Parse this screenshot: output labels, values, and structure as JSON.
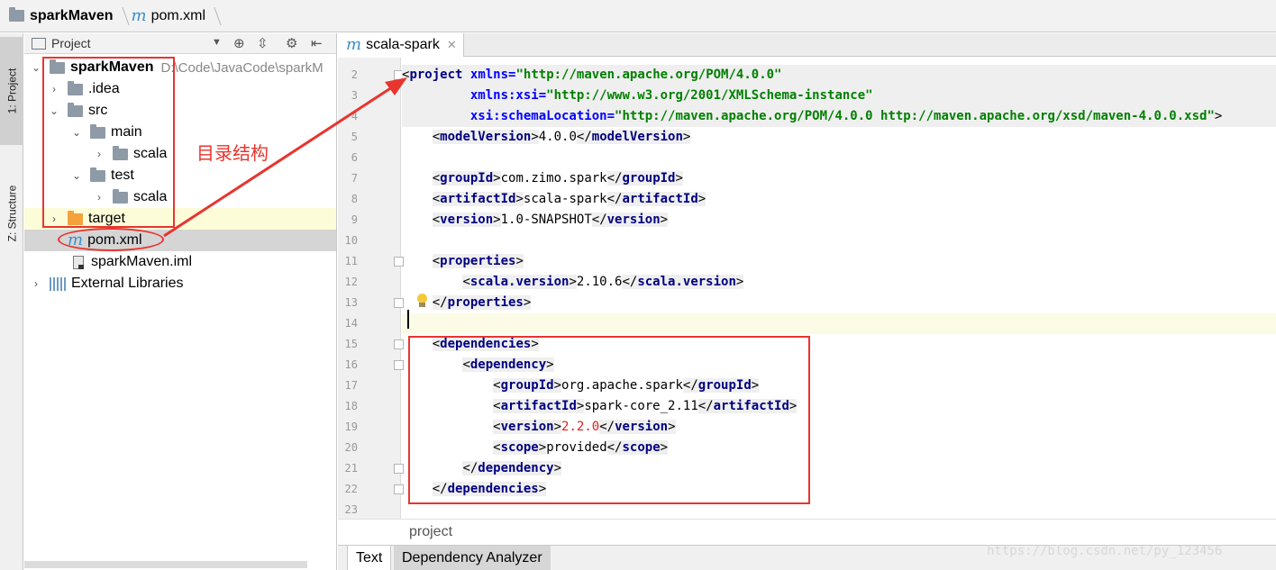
{
  "breadcrumb": {
    "project": "sparkMaven",
    "file": "pom.xml"
  },
  "toolstrip": {
    "project_tab": "1: Project",
    "structure_tab": "Z: Structure"
  },
  "project_panel": {
    "title": "Project",
    "tree": [
      {
        "label": "sparkMaven",
        "path": "D:\\Code\\JavaCode\\sparkM"
      },
      {
        "label": ".idea"
      },
      {
        "label": "src"
      },
      {
        "label": "main"
      },
      {
        "label": "scala"
      },
      {
        "label": "test"
      },
      {
        "label": "scala"
      },
      {
        "label": "target"
      },
      {
        "label": "pom.xml"
      },
      {
        "label": "sparkMaven.iml"
      },
      {
        "label": "External Libraries"
      }
    ]
  },
  "editor": {
    "tab_label": "scala-spark",
    "line_numbers": [
      "2",
      "3",
      "4",
      "5",
      "6",
      "7",
      "8",
      "9",
      "10",
      "11",
      "12",
      "13",
      "14",
      "15",
      "16",
      "17",
      "18",
      "19",
      "20",
      "21",
      "22",
      "23"
    ],
    "code": {
      "project_tag": "project",
      "xmlns_attr": "xmlns",
      "xmlns_val": "\"http://maven.apache.org/POM/4.0.0\"",
      "xsi_attr": "xmlns:xsi",
      "xsi_val": "\"http://www.w3.org/2001/XMLSchema-instance\"",
      "loc_attr": "xsi:schemaLocation",
      "loc_val": "\"http://maven.apache.org/POM/4.0.0 http://maven.apache.org/xsd/maven-4.0.0.xsd\"",
      "modelVersion_tag": "modelVersion",
      "modelVersion": "4.0.0",
      "groupId_tag": "groupId",
      "groupId": "com.zimo.spark",
      "artifactId_tag": "artifactId",
      "artifactId": "scala-spark",
      "version_tag": "version",
      "version": "1.0-SNAPSHOT",
      "properties_tag": "properties",
      "scala_version_tag": "scala.version",
      "scala_version": "2.10.6",
      "dependencies_tag": "dependencies",
      "dependency_tag": "dependency",
      "dep_groupId": "org.apache.spark",
      "dep_artifactId": "spark-core_2.11",
      "dep_version": "2.2.0",
      "scope_tag": "scope",
      "dep_scope": "provided"
    },
    "footer_crumb": "project",
    "bottom_tabs": [
      "Text",
      "Dependency Analyzer"
    ]
  },
  "annotation": {
    "label": "目录结构",
    "color": "#e8352e"
  },
  "watermark": "https://blog.csdn.net/py_123456"
}
